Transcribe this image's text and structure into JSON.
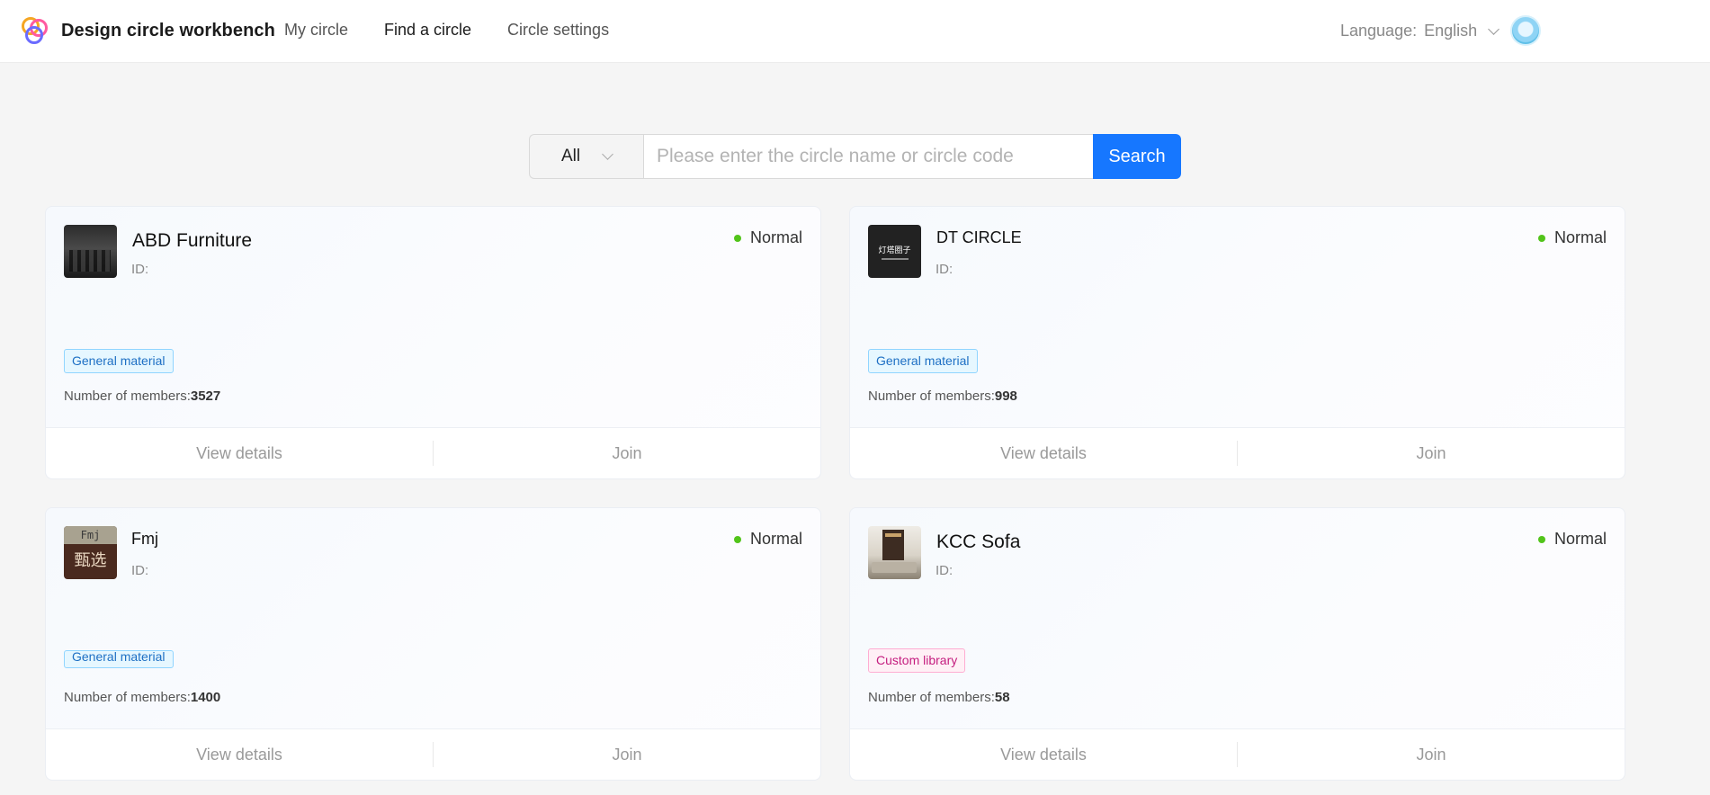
{
  "header": {
    "app_title": "Design circle workbench",
    "nav": [
      "My circle",
      "Find a circle",
      "Circle settings"
    ],
    "language_label": "Language:",
    "language_value": "English"
  },
  "search": {
    "filter_value": "All",
    "placeholder": "Please enter the circle name or circle code",
    "button_label": "Search"
  },
  "cards": [
    {
      "name": "ABD Furniture",
      "id_label": "ID:",
      "status": "Normal",
      "tag": "General material",
      "members_label": "Number of members:",
      "members": "3527",
      "view_label": "View details",
      "join_label": "Join"
    },
    {
      "name": "DT CIRCLE",
      "id_label": "ID:",
      "status": "Normal",
      "tag": "General material",
      "members_label": "Number of members:",
      "members": "998",
      "view_label": "View details",
      "join_label": "Join",
      "thumb_text": "灯塔圈子"
    },
    {
      "name": "Fmj",
      "id_label": "ID:",
      "status": "Normal",
      "tag": "General material",
      "members_label": "Number of members:",
      "members": "1400",
      "view_label": "View details",
      "join_label": "Join",
      "thumb_text_top": "Fmj",
      "thumb_text_bottom": "甄选"
    },
    {
      "name": "KCC Sofa",
      "id_label": "ID:",
      "status": "Normal",
      "tag": "Custom library",
      "members_label": "Number of members:",
      "members": "58",
      "view_label": "View details",
      "join_label": "Join"
    }
  ],
  "colors": {
    "primary": "#1677ff",
    "status_green": "#52c41a",
    "tag_blue": "#1d6fc4",
    "tag_pink": "#c41d7f"
  }
}
